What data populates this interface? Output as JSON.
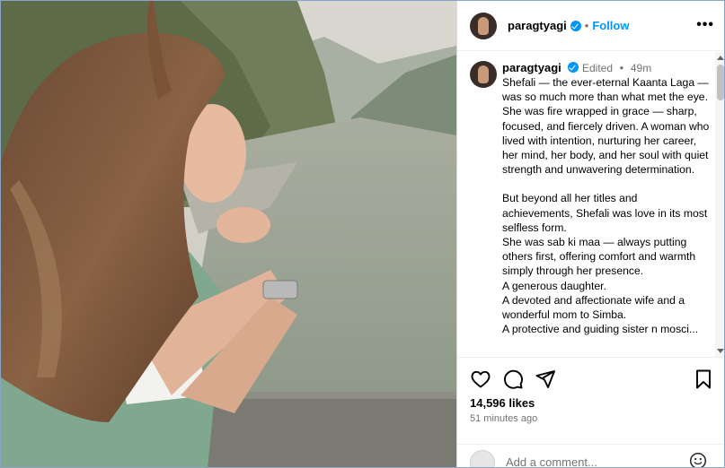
{
  "post": {
    "username": "paragtyagi",
    "follow_label": "Follow",
    "separator": "•",
    "more_label": "•••"
  },
  "caption": {
    "username": "paragtyagi",
    "edited_label": "Edited",
    "separator": "•",
    "age": "49m",
    "lines": [
      "Shefali — the ever-eternal Kaanta Laga — was so much more than what met the eye.",
      "She was fire wrapped in grace — sharp, focused, and fiercely driven. A woman who lived with intention, nurturing her career, her mind, her body, and her soul with quiet strength and unwavering determination.",
      "",
      "But beyond all her titles and achievements, Shefali was love in its most selfless form.",
      "She was sab ki maa — always putting others first, offering comfort and warmth simply through her presence.",
      "A generous daughter.",
      "A devoted and affectionate wife and a wonderful mom to Simba.",
      "A protective and guiding sister n mosci..."
    ]
  },
  "actions": {
    "likes": "14,596 likes",
    "time": "51 minutes ago",
    "icons": [
      "heart-icon",
      "comment-icon",
      "share-icon",
      "bookmark-icon"
    ]
  },
  "comment": {
    "placeholder": "Add a comment..."
  },
  "colors": {
    "accent": "#0095f6",
    "muted": "#737373",
    "border": "#dbdbdb"
  }
}
